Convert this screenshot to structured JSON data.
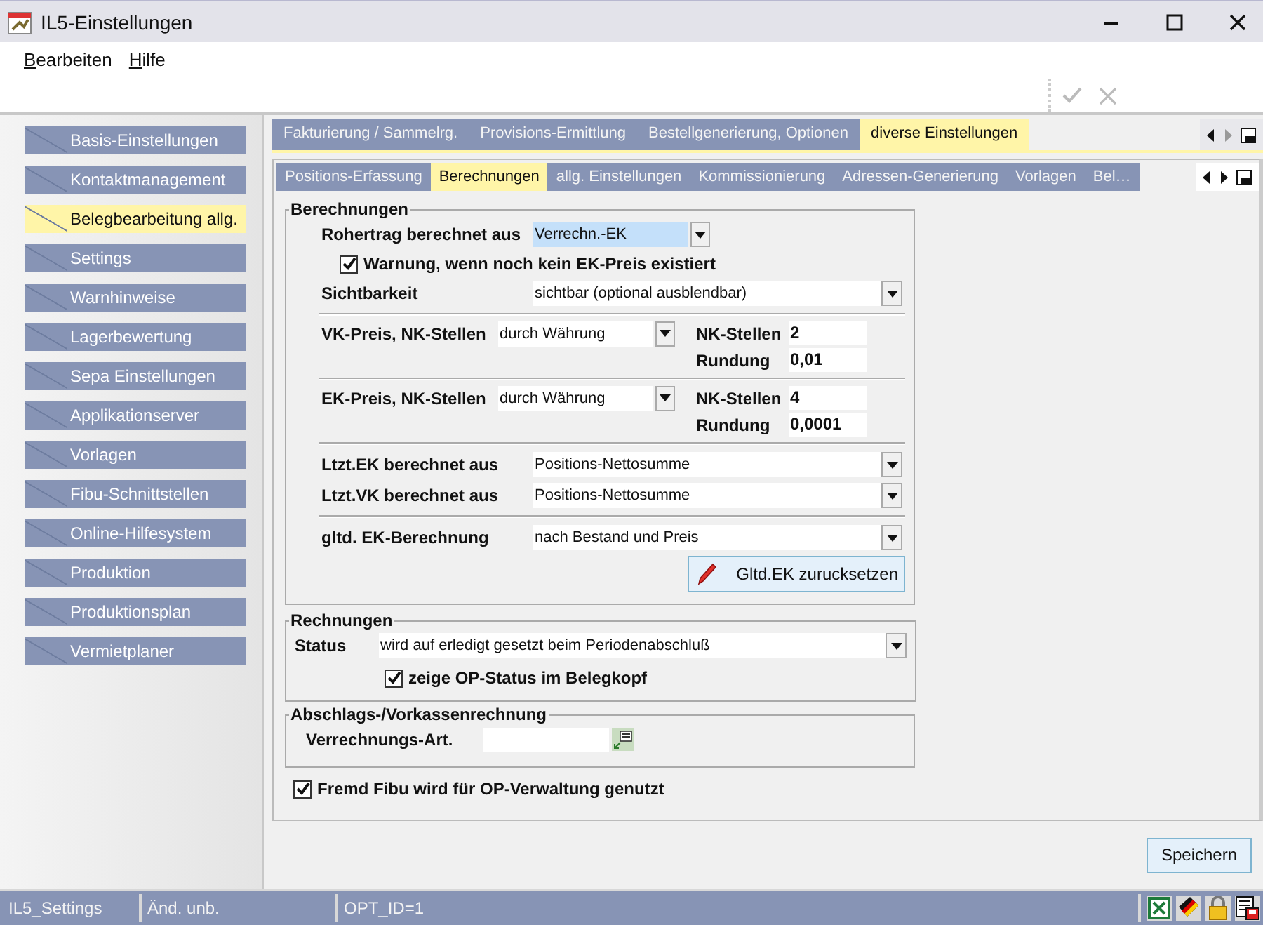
{
  "window": {
    "title": "IL5-Einstellungen"
  },
  "menu": [
    {
      "label": "Bearbeiten"
    },
    {
      "label": "Hilfe"
    }
  ],
  "toolbar": [
    {
      "kind": "check",
      "disabled": true
    },
    {
      "kind": "cancel",
      "disabled": true
    }
  ],
  "sidebar": {
    "items": [
      {
        "label": "Basis-Einstellungen",
        "selected": false
      },
      {
        "label": "Kontaktmanagement",
        "selected": false
      },
      {
        "label": "Belegbearbeitung allg.",
        "selected": true
      },
      {
        "label": "Settings",
        "selected": false
      },
      {
        "label": "Warnhinweise",
        "selected": false
      },
      {
        "label": "Lagerbewertung",
        "selected": false
      },
      {
        "label": "Sepa Einstellungen",
        "selected": false
      },
      {
        "label": "Applikationserver",
        "selected": false
      },
      {
        "label": "Vorlagen",
        "selected": false
      },
      {
        "label": "Fibu-Schnittstellen",
        "selected": false
      },
      {
        "label": "Online-Hilfesystem",
        "selected": false
      },
      {
        "label": "Produktion",
        "selected": false
      },
      {
        "label": "Produktionsplan",
        "selected": false
      },
      {
        "label": "Vermietplaner",
        "selected": false
      }
    ]
  },
  "tabs_main": [
    {
      "label": "Fakturierung / Sammelrg.",
      "selected": false
    },
    {
      "label": "Provisions-Ermittlung",
      "selected": false
    },
    {
      "label": "Bestellgenerierung, Optionen",
      "selected": false
    },
    {
      "label": "diverse Einstellungen",
      "selected": true
    }
  ],
  "tabs_sub": [
    {
      "label": "Positions-Erfassung",
      "selected": false
    },
    {
      "label": "Berechnungen",
      "selected": true
    },
    {
      "label": "allg. Einstellungen",
      "selected": false
    },
    {
      "label": "Kommissionierung",
      "selected": false
    },
    {
      "label": "Adressen-Generierung",
      "selected": false
    },
    {
      "label": "Vorlagen",
      "selected": false
    },
    {
      "label": "Bel…",
      "selected": false
    }
  ],
  "berechnungen": {
    "title": "Berechnungen",
    "rows": [
      {
        "kind": "combo",
        "short": true,
        "label": "Rohertrag berechnet aus",
        "value": "Verrechn.-EK",
        "focused": true
      },
      {
        "kind": "checkbox",
        "label": "Warnung, wenn noch kein EK-Preis existiert",
        "checked": true
      },
      {
        "kind": "combo",
        "short": false,
        "label": "Sichtbarkeit",
        "value": "sichtbar (optional ausblendbar)",
        "focused": false
      },
      {
        "kind": "divider"
      },
      {
        "kind": "price",
        "label": "VK-Preis, NK-Stellen",
        "value": "durch Währung",
        "nk_label": "NK-Stellen",
        "nk_value": "2",
        "rundung_label": "Rundung",
        "rundung_value": "0,01"
      },
      {
        "kind": "divider"
      },
      {
        "kind": "price",
        "label": "EK-Preis, NK-Stellen",
        "value": "durch Währung",
        "nk_label": "NK-Stellen",
        "nk_value": "4",
        "rundung_label": "Rundung",
        "rundung_value": "0,0001"
      },
      {
        "kind": "divider"
      },
      {
        "kind": "combo",
        "short": false,
        "label": "Ltzt.EK berechnet aus",
        "value": "Positions-Nettosumme",
        "focused": false
      },
      {
        "kind": "combo",
        "short": false,
        "label": "Ltzt.VK berechnet aus",
        "value": "Positions-Nettosumme",
        "focused": false
      },
      {
        "kind": "divider"
      },
      {
        "kind": "combo",
        "short": false,
        "label": "gltd. EK-Berechnung",
        "value": "nach Bestand und Preis",
        "focused": false
      },
      {
        "kind": "button",
        "label": "Gltd.EK zurucksetzen"
      }
    ]
  },
  "rechnungen": {
    "title": "Rechnungen",
    "status_label": "Status",
    "status_value": "wird auf erledigt gesetzt beim Periodenabschluß",
    "checkbox": {
      "label": "zeige OP-Status im Belegkopf",
      "checked": true
    }
  },
  "abschlag": {
    "title": "Abschlags-/Vorkassenrechnung",
    "field_label": "Verrechnungs-Art."
  },
  "fremd_fibu": {
    "label": "Fremd Fibu wird für OP-Verwaltung genutzt",
    "checked": true
  },
  "save_button": "Speichern",
  "status_bar": [
    "IL5_Settings",
    "Änd. unb.",
    "OPT_ID=1"
  ]
}
